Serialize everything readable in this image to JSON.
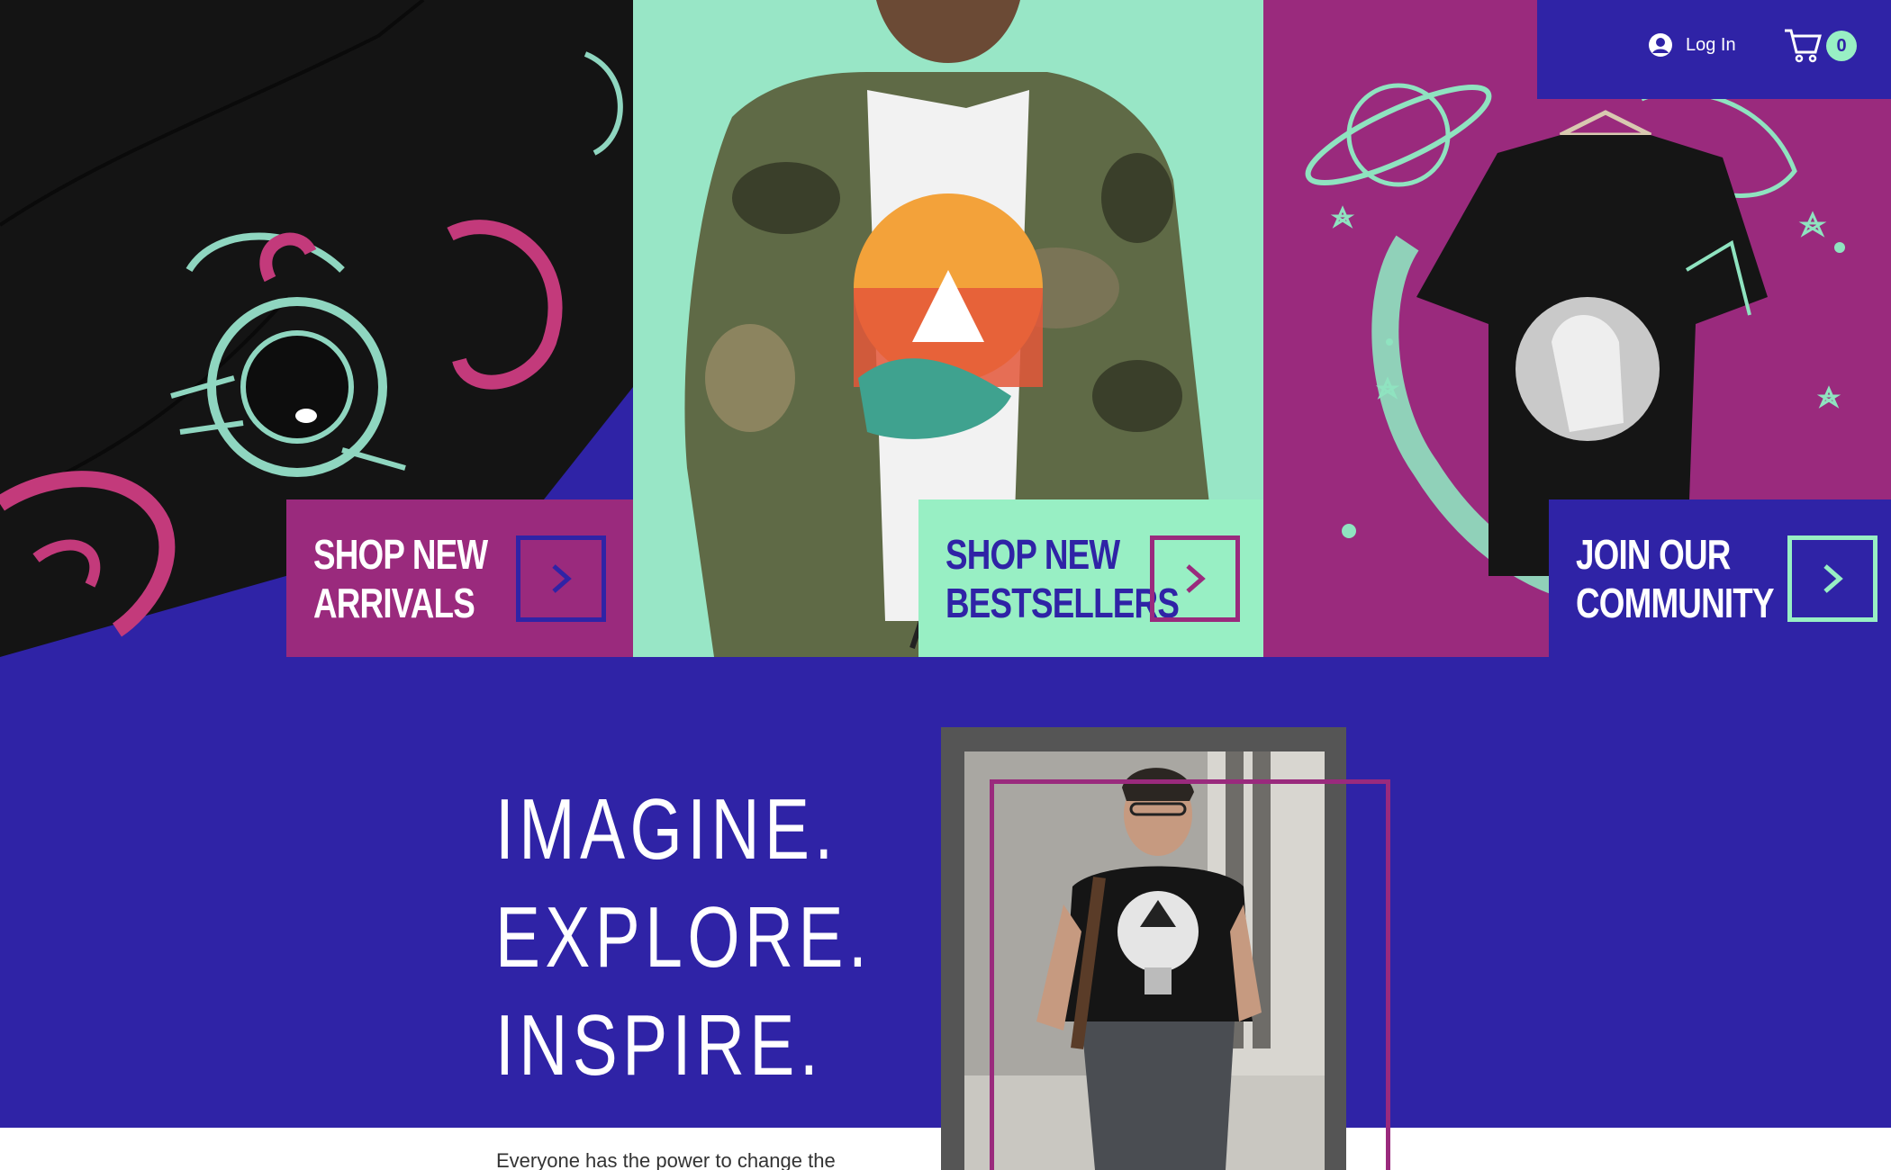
{
  "header": {
    "login_label": "Log In",
    "cart_count": "0"
  },
  "hero": {
    "panels": [
      {
        "image": "astronaut-octopus-tshirts"
      },
      {
        "image": "man-camo-jacket-ship-tshirt"
      },
      {
        "image": "astronaut-tshirt-on-hanger"
      }
    ],
    "ctas": [
      {
        "label": "SHOP NEW\nARRIVALS",
        "icon": "chevron-right-icon"
      },
      {
        "label": "SHOP NEW\nBESTSELLERS",
        "icon": "chevron-right-icon"
      },
      {
        "label": "JOIN OUR\nCOMMUNITY",
        "icon": "chevron-right-icon"
      }
    ]
  },
  "feature": {
    "tagline_1": "IMAGINE.",
    "tagline_2": "EXPLORE.",
    "tagline_3": "INSPIRE.",
    "image": "man-lightbulb-ship-tshirt",
    "body_text": "Everyone has the power to change the"
  },
  "colors": {
    "indigo": "#2f23a6",
    "magenta": "#9a2a7d",
    "mint": "#98efc4"
  }
}
